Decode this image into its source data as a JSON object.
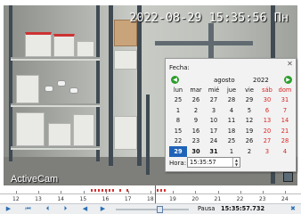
{
  "video": {
    "osd_timestamp": "2022-08-29 15:35:56 Пн",
    "brand": "ActiveCam"
  },
  "date_picker": {
    "label": "Fecha:",
    "month": "agosto",
    "year": "2022",
    "weekdays": [
      "lun",
      "mar",
      "mié",
      "jue",
      "vie",
      "sáb",
      "dom"
    ],
    "weeks": [
      [
        "25",
        "26",
        "27",
        "28",
        "29",
        "30",
        "31"
      ],
      [
        "1",
        "2",
        "3",
        "4",
        "5",
        "6",
        "7"
      ],
      [
        "8",
        "9",
        "10",
        "11",
        "12",
        "13",
        "14"
      ],
      [
        "15",
        "16",
        "17",
        "18",
        "19",
        "20",
        "21"
      ],
      [
        "22",
        "23",
        "24",
        "25",
        "26",
        "27",
        "28"
      ],
      [
        "29",
        "30",
        "31",
        "1",
        "2",
        "3",
        "4"
      ]
    ],
    "selected_day": "29",
    "time_label": "Hora:",
    "time_value": "15:35:57"
  },
  "timeline": {
    "hours": [
      "12",
      "13",
      "14",
      "15",
      "16",
      "17",
      "18",
      "19",
      "20",
      "21",
      "22",
      "23",
      "24"
    ]
  },
  "controls": {
    "status": "Pausa",
    "timecode": "15:35:57.732"
  },
  "colors": {
    "selected_day": "#1f63b8",
    "weekend": "#d22222",
    "nav_button": "#2e9d2e",
    "recording_mark": "#d33333"
  },
  "icons": {
    "nav_prev": "green-left-arrow-icon",
    "nav_next": "green-right-arrow-icon",
    "close": "close-icon",
    "play": "play-icon"
  }
}
